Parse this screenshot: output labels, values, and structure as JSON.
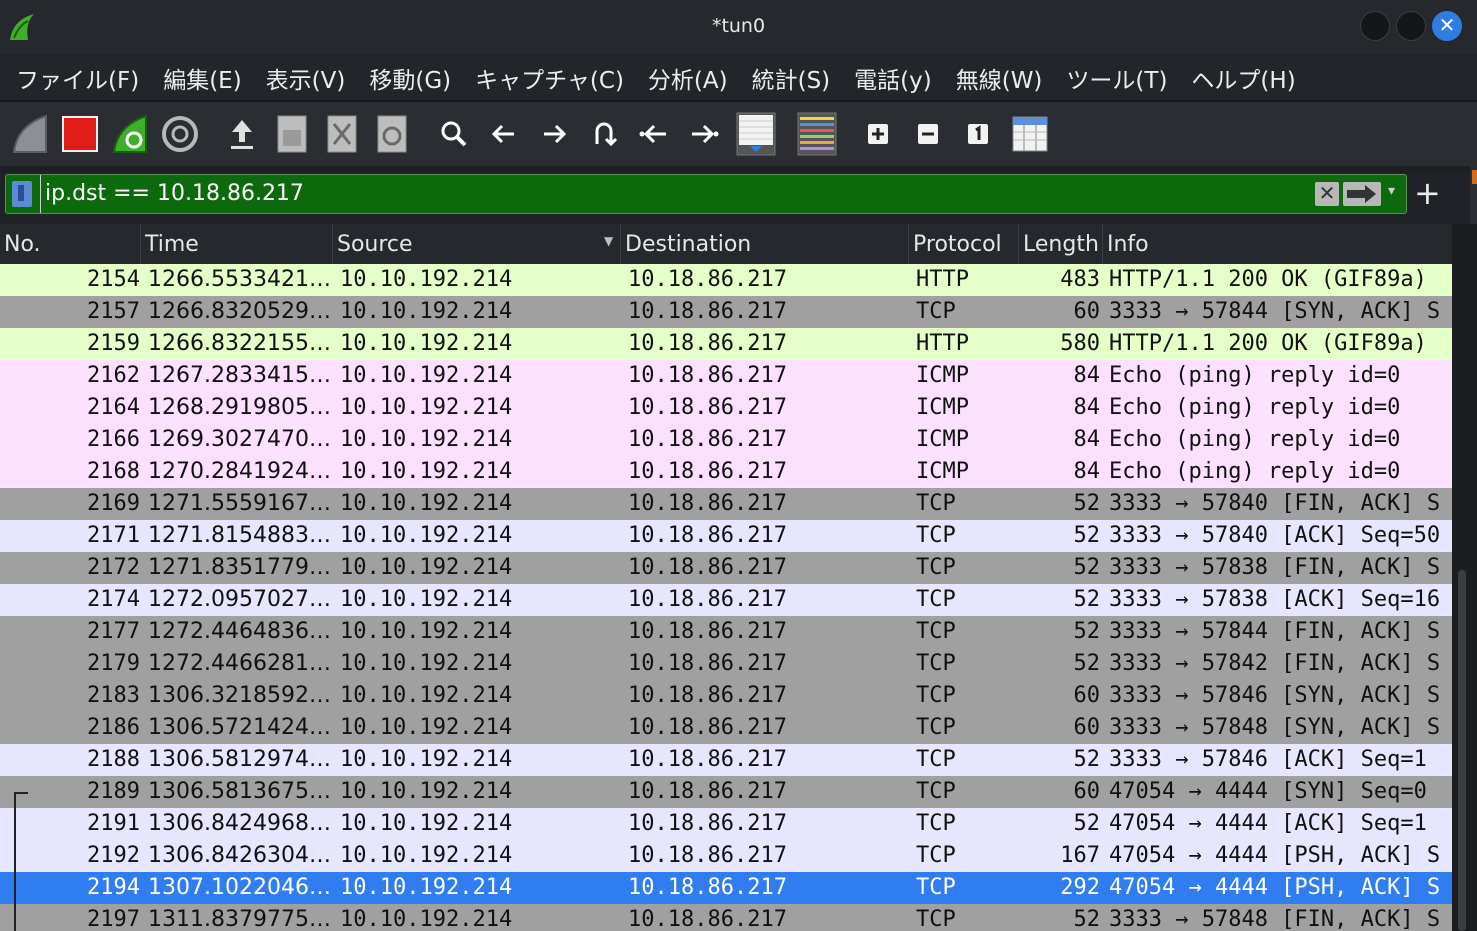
{
  "window": {
    "title": "*tun0"
  },
  "menu": [
    "ファイル(F)",
    "編集(E)",
    "表示(V)",
    "移動(G)",
    "キャプチャ(C)",
    "分析(A)",
    "統計(S)",
    "電話(y)",
    "無線(W)",
    "ツール(T)",
    "ヘルプ(H)"
  ],
  "toolbar": {
    "icons": [
      "shark-fin-icon",
      "stop-capture-icon",
      "restart-capture-icon",
      "capture-options-icon",
      "open-file-icon",
      "save-file-icon",
      "close-file-icon",
      "reload-file-icon",
      "find-packet-icon",
      "go-back-icon",
      "go-forward-icon",
      "go-to-packet-icon",
      "first-packet-icon",
      "last-packet-icon",
      "auto-scroll-icon",
      "colorize-icon",
      "zoom-in-icon",
      "zoom-out-icon",
      "normal-size-icon",
      "resize-columns-icon"
    ]
  },
  "filter": {
    "value": "ip.dst == 10.18.86.217"
  },
  "columns": [
    "No.",
    "Time",
    "Source",
    "Destination",
    "Protocol",
    "Length",
    "Info"
  ],
  "colors": {
    "http": "#e4ffc7",
    "icmp": "#fce0ff",
    "tcp": "#e7e6ff",
    "tcp_flag": "#a0a0a0",
    "selected": "#2f7df0",
    "filter_valid": "#0c6a0c"
  },
  "packets": [
    {
      "no": "2154",
      "time": "1266.5533421…",
      "src": "10.10.192.214",
      "dst": "10.18.86.217",
      "proto": "HTTP",
      "len": "483",
      "info": "HTTP/1.1 200 OK  (GIF89a)",
      "style": "http"
    },
    {
      "no": "2157",
      "time": "1266.8320529…",
      "src": "10.10.192.214",
      "dst": "10.18.86.217",
      "proto": "TCP",
      "len": "60",
      "info": "3333 → 57844 [SYN, ACK] S",
      "style": "tcpflag"
    },
    {
      "no": "2159",
      "time": "1266.8322155…",
      "src": "10.10.192.214",
      "dst": "10.18.86.217",
      "proto": "HTTP",
      "len": "580",
      "info": "HTTP/1.1 200 OK  (GIF89a)",
      "style": "http"
    },
    {
      "no": "2162",
      "time": "1267.2833415…",
      "src": "10.10.192.214",
      "dst": "10.18.86.217",
      "proto": "ICMP",
      "len": "84",
      "info": "Echo (ping) reply    id=0",
      "style": "icmp"
    },
    {
      "no": "2164",
      "time": "1268.2919805…",
      "src": "10.10.192.214",
      "dst": "10.18.86.217",
      "proto": "ICMP",
      "len": "84",
      "info": "Echo (ping) reply    id=0",
      "style": "icmp"
    },
    {
      "no": "2166",
      "time": "1269.3027470…",
      "src": "10.10.192.214",
      "dst": "10.18.86.217",
      "proto": "ICMP",
      "len": "84",
      "info": "Echo (ping) reply    id=0",
      "style": "icmp"
    },
    {
      "no": "2168",
      "time": "1270.2841924…",
      "src": "10.10.192.214",
      "dst": "10.18.86.217",
      "proto": "ICMP",
      "len": "84",
      "info": "Echo (ping) reply    id=0",
      "style": "icmp"
    },
    {
      "no": "2169",
      "time": "1271.5559167…",
      "src": "10.10.192.214",
      "dst": "10.18.86.217",
      "proto": "TCP",
      "len": "52",
      "info": "3333 → 57840 [FIN, ACK] S",
      "style": "tcpflag"
    },
    {
      "no": "2171",
      "time": "1271.8154883…",
      "src": "10.10.192.214",
      "dst": "10.18.86.217",
      "proto": "TCP",
      "len": "52",
      "info": "3333 → 57840 [ACK] Seq=50",
      "style": "tcp"
    },
    {
      "no": "2172",
      "time": "1271.8351779…",
      "src": "10.10.192.214",
      "dst": "10.18.86.217",
      "proto": "TCP",
      "len": "52",
      "info": "3333 → 57838 [FIN, ACK] S",
      "style": "tcpflag"
    },
    {
      "no": "2174",
      "time": "1272.0957027…",
      "src": "10.10.192.214",
      "dst": "10.18.86.217",
      "proto": "TCP",
      "len": "52",
      "info": "3333 → 57838 [ACK] Seq=16",
      "style": "tcp"
    },
    {
      "no": "2177",
      "time": "1272.4464836…",
      "src": "10.10.192.214",
      "dst": "10.18.86.217",
      "proto": "TCP",
      "len": "52",
      "info": "3333 → 57844 [FIN, ACK] S",
      "style": "tcpflag"
    },
    {
      "no": "2179",
      "time": "1272.4466281…",
      "src": "10.10.192.214",
      "dst": "10.18.86.217",
      "proto": "TCP",
      "len": "52",
      "info": "3333 → 57842 [FIN, ACK] S",
      "style": "tcpflag"
    },
    {
      "no": "2183",
      "time": "1306.3218592…",
      "src": "10.10.192.214",
      "dst": "10.18.86.217",
      "proto": "TCP",
      "len": "60",
      "info": "3333 → 57846 [SYN, ACK] S",
      "style": "tcpflag"
    },
    {
      "no": "2186",
      "time": "1306.5721424…",
      "src": "10.10.192.214",
      "dst": "10.18.86.217",
      "proto": "TCP",
      "len": "60",
      "info": "3333 → 57848 [SYN, ACK] S",
      "style": "tcpflag"
    },
    {
      "no": "2188",
      "time": "1306.5812974…",
      "src": "10.10.192.214",
      "dst": "10.18.86.217",
      "proto": "TCP",
      "len": "52",
      "info": "3333 → 57846 [ACK] Seq=1",
      "style": "tcp"
    },
    {
      "no": "2189",
      "time": "1306.5813675…",
      "src": "10.10.192.214",
      "dst": "10.18.86.217",
      "proto": "TCP",
      "len": "60",
      "info": "47054 → 4444 [SYN] Seq=0",
      "style": "tcpflag"
    },
    {
      "no": "2191",
      "time": "1306.8424968…",
      "src": "10.10.192.214",
      "dst": "10.18.86.217",
      "proto": "TCP",
      "len": "52",
      "info": "47054 → 4444 [ACK] Seq=1",
      "style": "tcp"
    },
    {
      "no": "2192",
      "time": "1306.8426304…",
      "src": "10.10.192.214",
      "dst": "10.18.86.217",
      "proto": "TCP",
      "len": "167",
      "info": "47054 → 4444 [PSH, ACK] S",
      "style": "tcp"
    },
    {
      "no": "2194",
      "time": "1307.1022046…",
      "src": "10.10.192.214",
      "dst": "10.18.86.217",
      "proto": "TCP",
      "len": "292",
      "info": "47054 → 4444 [PSH, ACK] S",
      "style": "selected"
    },
    {
      "no": "2197",
      "time": "1311.8379775…",
      "src": "10.10.192.214",
      "dst": "10.18.86.217",
      "proto": "TCP",
      "len": "52",
      "info": "3333 → 57848 [FIN, ACK] S",
      "style": "tcpflag"
    }
  ]
}
